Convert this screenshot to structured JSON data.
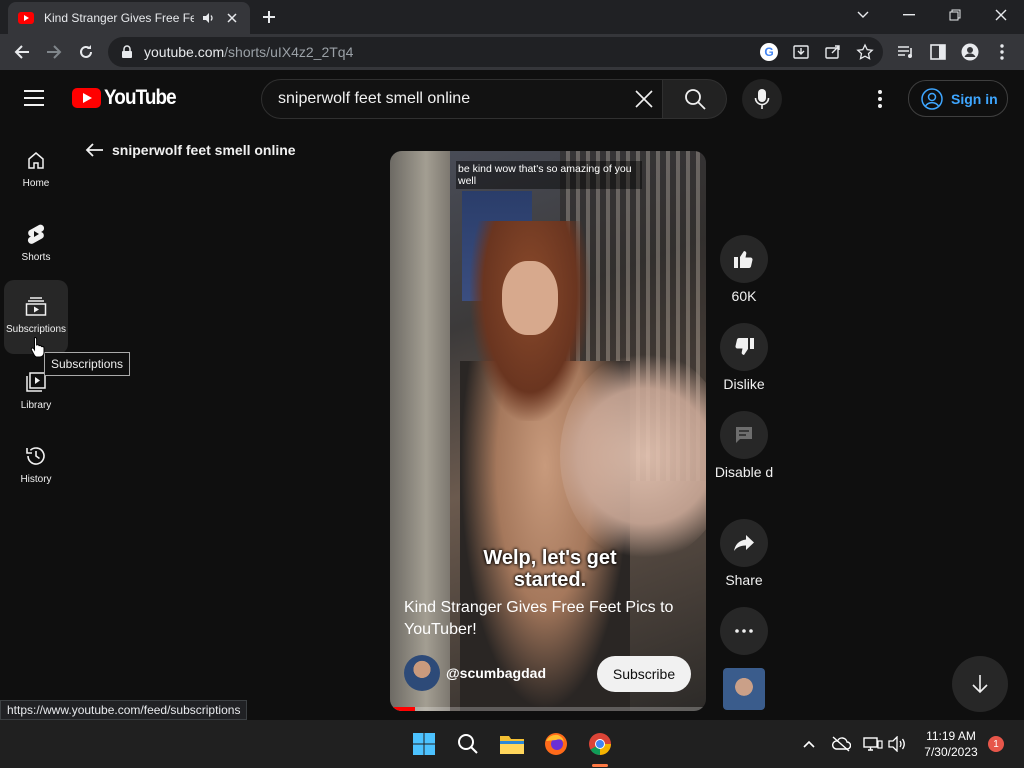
{
  "browser": {
    "tab_title": "Kind Stranger Gives Free Feet",
    "url_host": "youtube.com",
    "url_path": "/shorts/uIX4z2_2Tq4",
    "status_url": "https://www.youtube.com/feed/subscriptions"
  },
  "header": {
    "logo_text": "YouTube",
    "search_query": "sniperwolf feet smell online",
    "signin_label": "Sign in"
  },
  "sidebar": {
    "items": [
      {
        "label": "Home",
        "icon": "home-icon"
      },
      {
        "label": "Shorts",
        "icon": "shorts-icon"
      },
      {
        "label": "Subscriptions",
        "icon": "subscriptions-icon"
      },
      {
        "label": "Library",
        "icon": "library-icon"
      },
      {
        "label": "History",
        "icon": "history-icon"
      }
    ],
    "tooltip": "Subscriptions"
  },
  "back_label": "sniperwolf feet smell online",
  "short": {
    "overlay_comment": "be kind wow that's so amazing of you well",
    "caption": "Welp, let's get started.",
    "title": "Kind Stranger Gives Free Feet Pics to YouTuber!",
    "channel": "@scumbagdad",
    "subscribe_label": "Subscribe",
    "progress": 0.08
  },
  "actions": {
    "likes": "60K",
    "dislike_label": "Dislike",
    "comments_label": "Disable d",
    "share_label": "Share"
  },
  "taskbar": {
    "time": "11:19 AM",
    "date": "7/30/2023",
    "notification_count": "1"
  },
  "colors": {
    "youtube_red": "#ff0000",
    "link_blue": "#3ea6ff",
    "background": "#0f0f0f"
  }
}
